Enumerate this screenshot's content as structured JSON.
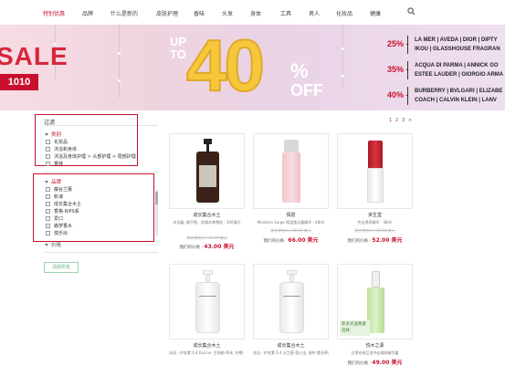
{
  "nav": {
    "items": [
      "特别优惠",
      "品牌",
      "什么是新的",
      "皮肤护理",
      "香味",
      "头发",
      "身体",
      "工具",
      "男人",
      "化妆品",
      "健康"
    ],
    "active_index": 0
  },
  "banner": {
    "sale_word": "SALE",
    "sale_badge": "1010",
    "up_to": "UP TO",
    "big_number": "40",
    "percent_sign": "%",
    "off": "OFF",
    "tiers": [
      {
        "pct": "25% -",
        "brands_line1": "LA MER | AVEDA | DIOR | DIPTY",
        "brands_line2": "IKOU | GLASSHOUSE FRAGRAN"
      },
      {
        "pct": "35% -",
        "brands_line1": "ACQUA DI PARMA | ANNICK GO",
        "brands_line2": "ESTEE LAUDER | GIORGIO ARMA"
      },
      {
        "pct": "40% -",
        "brands_line1": "BURBERRY | BVLGARI | ELIZABE",
        "brands_line2": "COACH | CALVIN KLEIN | LANV"
      }
    ],
    "colors": {
      "sale_red": "#d7263d",
      "balloon_gold": "#f6c73a",
      "tier_red": "#c8102e"
    }
  },
  "filter": {
    "title": "过滤",
    "category": {
      "head": "类别",
      "options": [
        "化妆品",
        "沐浴和身体",
        "沐浴及身体护理 > 头部护理 > 局部护理",
        "香味"
      ]
    },
    "brand": {
      "head": "品牌",
      "options": [
        "藤谷兰蕾",
        "新濠",
        "成长集合木土",
        "香格·RIPS系",
        "爱口",
        "森罗香水",
        "悦乐出"
      ]
    },
    "price_head": "价格",
    "clear_label": "清除所有"
  },
  "pager": {
    "pages": [
      "1",
      "2",
      "3",
      ">"
    ],
    "current": "1"
  },
  "products": [
    {
      "brand": "成长集合木土",
      "desc": "沐浴露, 佛手柑、玫瑰木和雪松 - 300毫升",
      "old": "建议零售价 : 47.00 美元",
      "price_label": "我们的价格 :",
      "price": "43.00 美元"
    },
    {
      "brand": "倩碧",
      "desc": "Moisture Surge 保湿锁水露精华 - 48ml",
      "old": "建议零售价 : 80.00 美元",
      "price_label": "我们的价格 :",
      "price": "66.00 美元"
    },
    {
      "brand": "资生堂",
      "desc": "完全透亮精华 - 48ml",
      "old": "建议零售价 : 56.00 美元",
      "price_label": "我们的价格 :",
      "price": "52.00 美元"
    },
    {
      "brand": "成长集合木土",
      "desc": "沐浴 - 护发素 6.4 Racine, 生物根·草本, 柠檬 - 500毫升",
      "old": "",
      "price_label": "",
      "price": ""
    },
    {
      "brand": "成长集合木土",
      "desc": "沐浴 - 护发素 6.4 天竺葵·萤火虫, 香柠·薰衣草类 - 500毫升",
      "old": "",
      "price_label": "",
      "price": ""
    },
    {
      "brand": "悦木之源",
      "desc": "日常充电巨浪冲击焕肤精华露",
      "old": "",
      "price_label": "我们的价格 :",
      "price": "49.00 美元",
      "tag": "新多买送我爱选择"
    }
  ]
}
